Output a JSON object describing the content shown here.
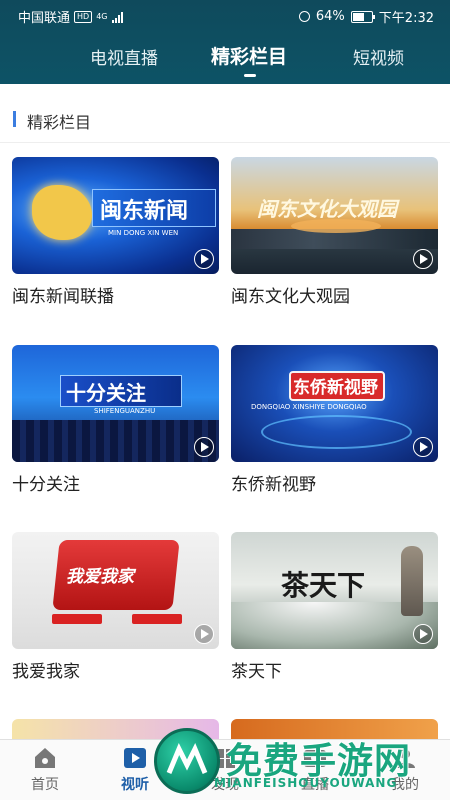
{
  "status_bar": {
    "carrier": "中国联通",
    "hd": "HD",
    "network": "4G",
    "battery_text": "64%",
    "battery_level": 0.64,
    "time": "下午2:32"
  },
  "top_tabs": [
    {
      "label": "电视直播",
      "active": false
    },
    {
      "label": "精彩栏目",
      "active": true
    },
    {
      "label": "短视频",
      "active": false
    }
  ],
  "section": {
    "title": "精彩栏目"
  },
  "cards": [
    {
      "title": "闽东新闻联播",
      "thumb_title": "闽东新闻",
      "thumb_sub": "MIN DONG XIN WEN"
    },
    {
      "title": "闽东文化大观园",
      "thumb_title": "闽东文化大观园",
      "thumb_sub": ""
    },
    {
      "title": "十分关注",
      "thumb_title": "十分关注",
      "thumb_sub": "SHIFENGUANZHU"
    },
    {
      "title": "东侨新视野",
      "thumb_title": "东侨新视野",
      "thumb_sub": "DONGQIAO  XINSHIYE  DONGQIAO"
    },
    {
      "title": "我爱我家",
      "thumb_title": "我爱我家",
      "thumb_sub": ""
    },
    {
      "title": "茶天下",
      "thumb_title": "茶天下",
      "thumb_sub": ""
    }
  ],
  "bottom_nav": [
    {
      "label": "首页",
      "active": false,
      "icon": "home-icon"
    },
    {
      "label": "视听",
      "active": true,
      "icon": "play-square-icon"
    },
    {
      "label": "发现",
      "active": false,
      "icon": "discover-icon"
    },
    {
      "label": "直播",
      "active": false,
      "icon": "live-icon"
    },
    {
      "label": "我的",
      "active": false,
      "icon": "user-icon"
    }
  ],
  "watermark": {
    "text": "免费手游网",
    "sub": "MIANFEISHOUYOUWANG"
  }
}
